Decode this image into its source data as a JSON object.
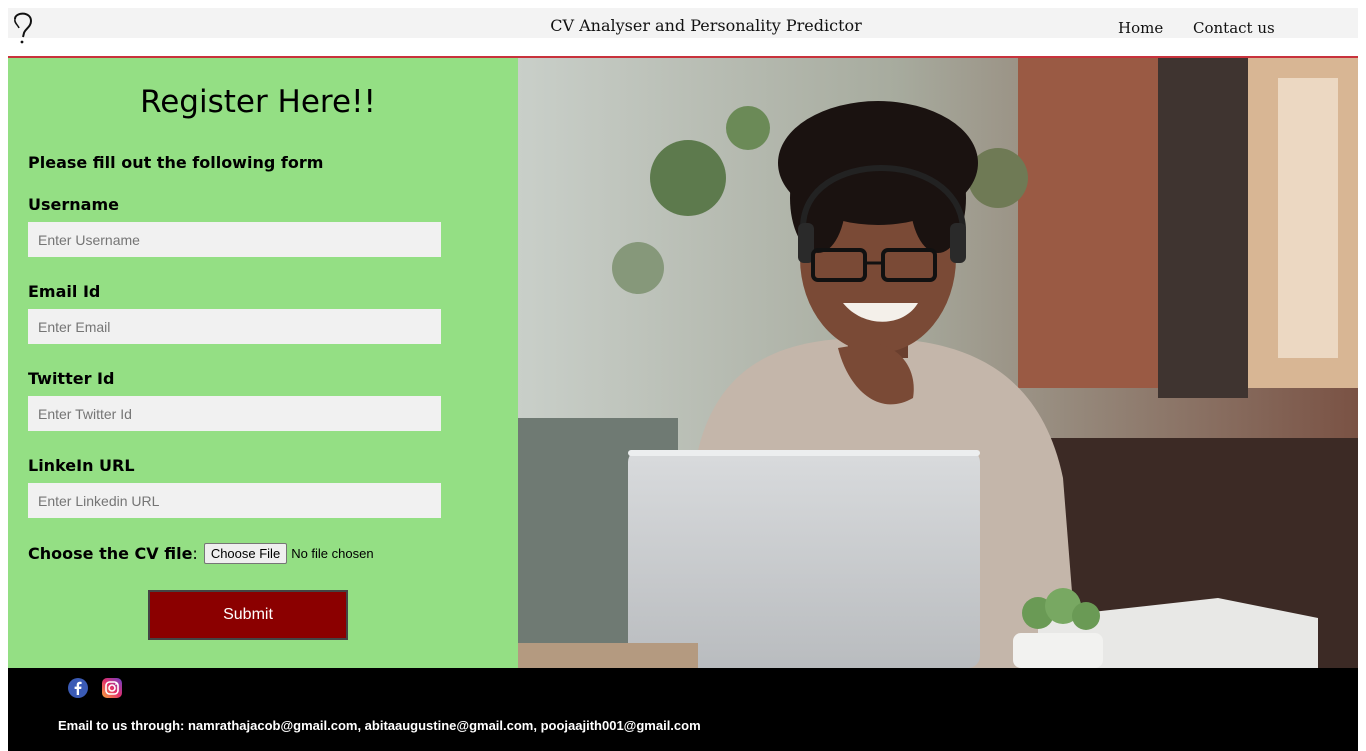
{
  "header": {
    "title": "CV Analyser and Personality Predictor",
    "nav": {
      "home": "Home",
      "contact": "Contact us"
    }
  },
  "form": {
    "title": "Register Here!!",
    "subtitle": "Please fill out the following form",
    "fields": [
      {
        "label": "Username",
        "placeholder": "Enter Username"
      },
      {
        "label": "Email Id",
        "placeholder": "Enter Email"
      },
      {
        "label": "Twitter Id",
        "placeholder": "Enter Twitter Id"
      },
      {
        "label": "LinkeIn URL",
        "placeholder": "Enter Linkedin URL"
      }
    ],
    "file": {
      "label": "Choose the CV file",
      "colon": ":",
      "button": "Choose File",
      "status": "No file chosen"
    },
    "submit": "Submit"
  },
  "colors": {
    "panel": "#94df84",
    "submit": "#8b0000",
    "accent_line": "#c8323c"
  },
  "footer": {
    "icons": [
      "facebook-icon",
      "instagram-icon"
    ],
    "email_text": "Email to us through: namrathajacob@gmail.com, abitaaugustine@gmail.com, poojaajith001@gmail.com"
  }
}
